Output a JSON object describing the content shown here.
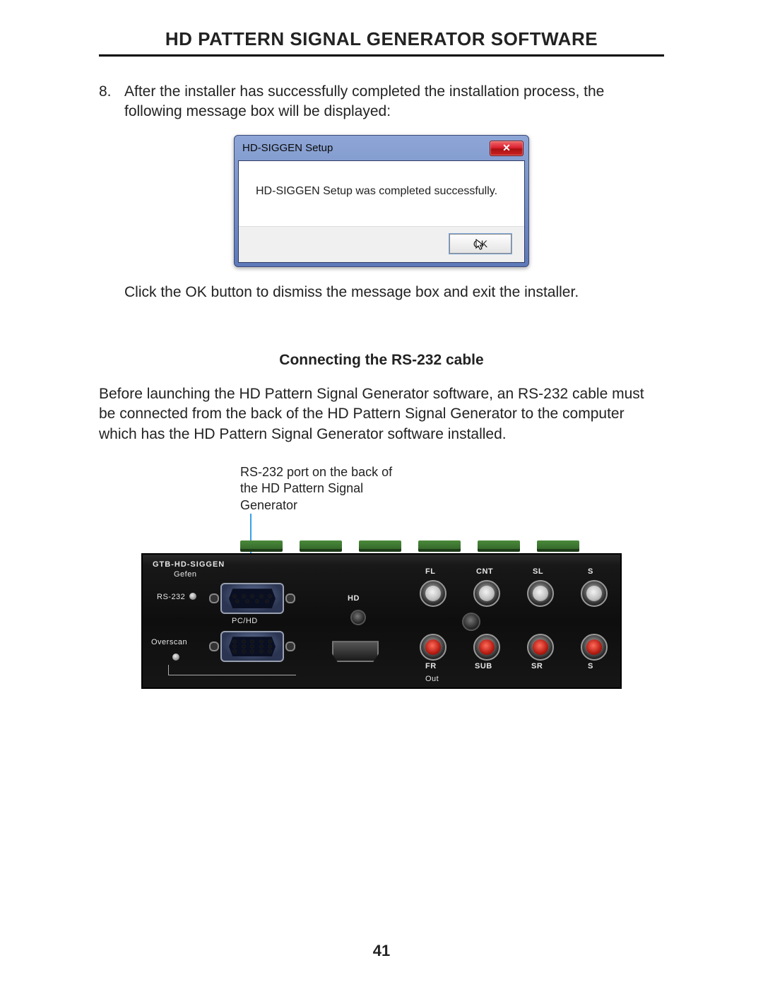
{
  "header": {
    "title": "HD PATTERN SIGNAL GENERATOR SOFTWARE"
  },
  "step": {
    "number": "8.",
    "text": "After the installer has successfully completed the installation process, the following message box will be displayed:"
  },
  "dialog": {
    "title": "HD-SIGGEN Setup",
    "message": "HD-SIGGEN Setup was completed successfully.",
    "ok_label": "OK",
    "close_glyph": "✕"
  },
  "after_dialog": "Click the OK button to dismiss the message box and exit the installer.",
  "section": {
    "heading": "Connecting the RS-232 cable"
  },
  "rs232_para": "Before launching the HD Pattern Signal Generator software, an RS-232 cable must be connected from the back of the HD Pattern Signal Generator to the computer which has the HD Pattern Signal Generator software installed.",
  "callout": "RS-232 port on the back of the HD Pattern Signal Generator",
  "hardware": {
    "model": "GTB-HD-SIGGEN",
    "brand": "Gefen",
    "labels": {
      "rs232": "RS-232",
      "pchd": "PC/HD",
      "overscan": "Overscan",
      "hd": "HD",
      "fl": "FL",
      "cnt": "CNT",
      "sl": "SL",
      "s_top": "S",
      "fr": "FR",
      "sub": "SUB",
      "sr": "SR",
      "s_bot": "S",
      "out": "Out"
    }
  },
  "page_number": "41"
}
